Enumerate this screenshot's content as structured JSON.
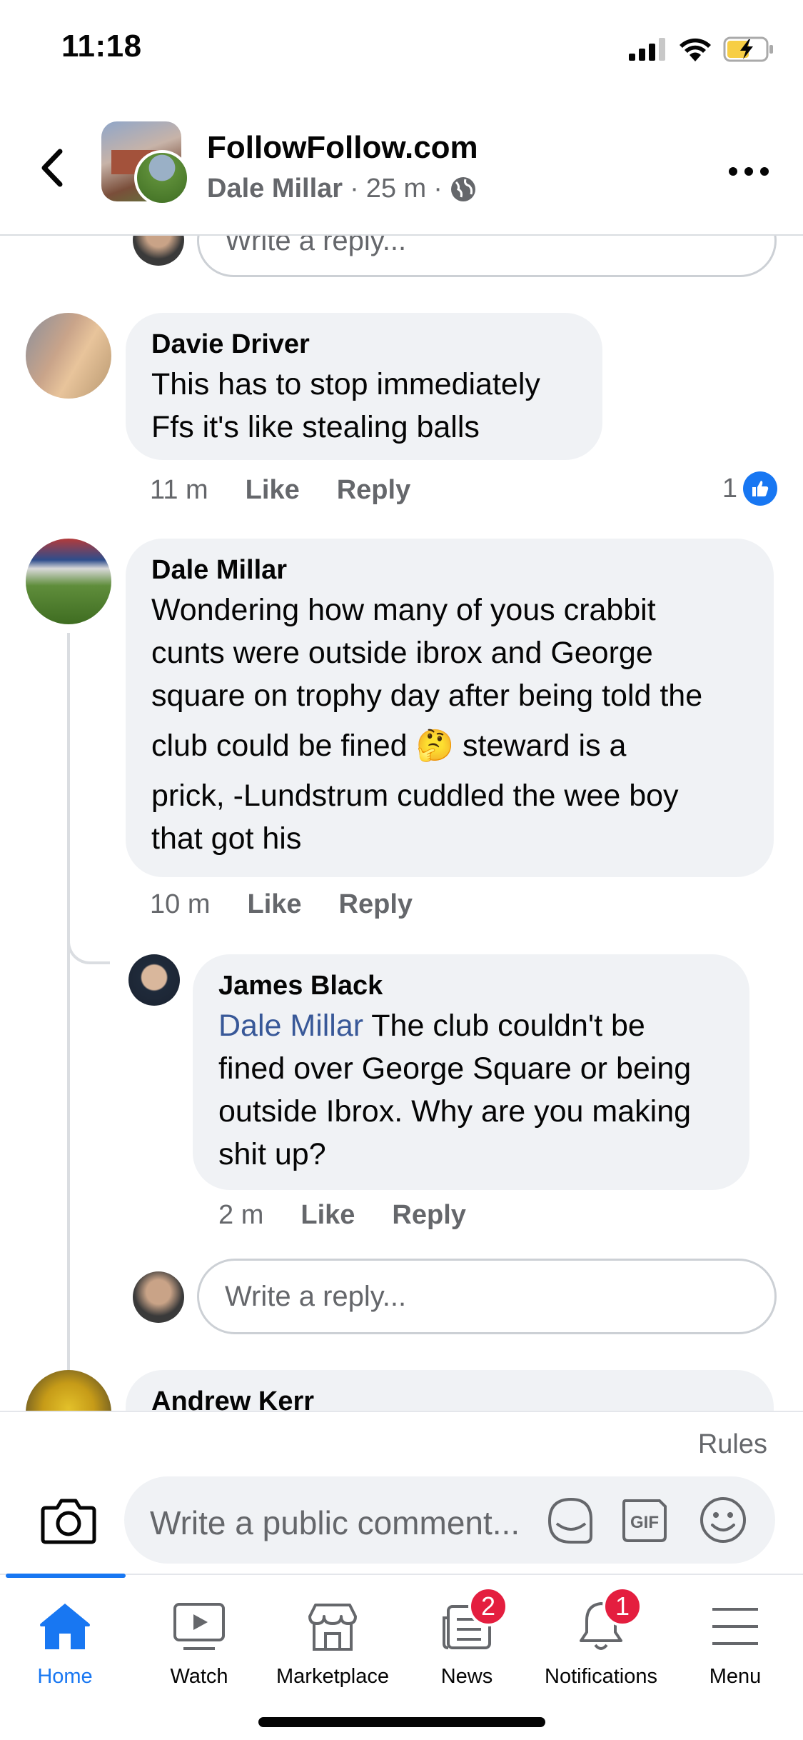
{
  "status_bar": {
    "time": "11:18"
  },
  "header": {
    "group_name": "FollowFollow.com",
    "author": "Dale Millar",
    "time_ago": "25 m",
    "separator": "·"
  },
  "top_reply_placeholder": "Write a reply...",
  "comments": [
    {
      "name": "Davie Driver",
      "lines": [
        "This has to  stop immediately",
        "Ffs it's like stealing balls"
      ],
      "time": "11 m",
      "like_label": "Like",
      "reply_label": "Reply",
      "like_count": "1"
    },
    {
      "name": "Dale Millar",
      "lines": [
        "Wondering how many of yous crabbit",
        "cunts were outside ibrox and George",
        "square on trophy day after being told the",
        "club could be fined 🤔 steward is a",
        "prick, -Lundstrum cuddled the wee boy",
        "that got his"
      ],
      "time": "10 m",
      "like_label": "Like",
      "reply_label": "Reply"
    },
    {
      "name": "James Black",
      "mention": "Dale Millar",
      "lines": [
        " The club couldn't be",
        "fined over George Square or being",
        "outside Ibrox. Why are you making",
        "shit up?"
      ],
      "time": "2 m",
      "like_label": "Like",
      "reply_label": "Reply"
    },
    {
      "name": "Andrew Kerr"
    }
  ],
  "thread_reply_placeholder": "Write a reply...",
  "composer": {
    "rules_label": "Rules",
    "placeholder": "Write a public comment...",
    "gif_label": "GIF"
  },
  "tabbar": {
    "tabs": [
      {
        "label": "Home",
        "icon": "home-icon",
        "active": true
      },
      {
        "label": "Watch",
        "icon": "watch-icon"
      },
      {
        "label": "Marketplace",
        "icon": "marketplace-icon"
      },
      {
        "label": "News",
        "icon": "news-icon",
        "badge": "2"
      },
      {
        "label": "Notifications",
        "icon": "bell-icon",
        "badge": "1"
      },
      {
        "label": "Menu",
        "icon": "menu-icon"
      }
    ]
  },
  "colors": {
    "accent": "#1877f2",
    "bubble": "#f0f2f5",
    "badge": "#e41e3f",
    "secondary_text": "#65676b",
    "mention": "#385898"
  }
}
